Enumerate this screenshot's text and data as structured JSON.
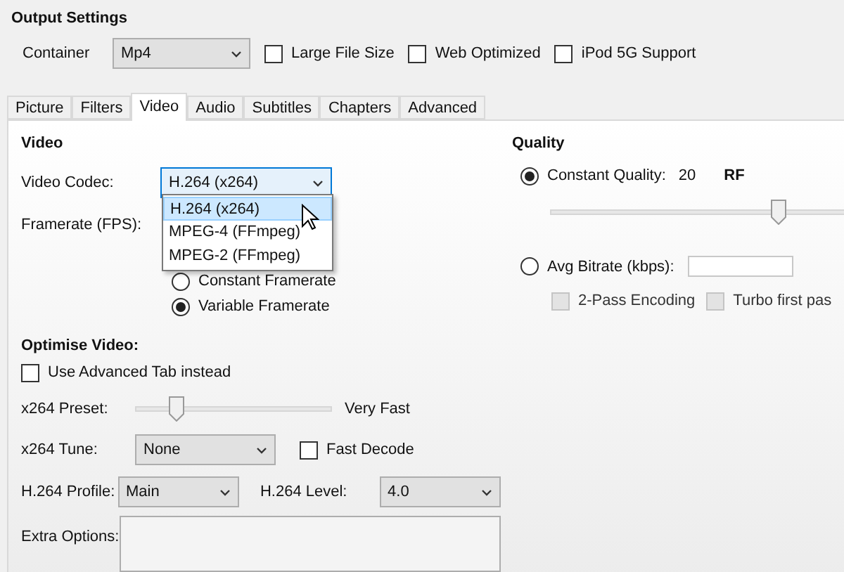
{
  "output_settings": {
    "title": "Output Settings",
    "container_label": "Container",
    "container_value": "Mp4",
    "options": [
      {
        "label": "Large File Size",
        "checked": false
      },
      {
        "label": "Web Optimized",
        "checked": false
      },
      {
        "label": "iPod 5G Support",
        "checked": false
      }
    ]
  },
  "tabs": [
    {
      "label": "Picture",
      "selected": false
    },
    {
      "label": "Filters",
      "selected": false
    },
    {
      "label": "Video",
      "selected": true
    },
    {
      "label": "Audio",
      "selected": false
    },
    {
      "label": "Subtitles",
      "selected": false
    },
    {
      "label": "Chapters",
      "selected": false
    },
    {
      "label": "Advanced",
      "selected": false
    }
  ],
  "video": {
    "title": "Video",
    "codec_label": "Video Codec:",
    "codec_value": "H.264 (x264)",
    "codec_options": [
      {
        "label": "H.264 (x264)",
        "selected": true
      },
      {
        "label": "MPEG-4 (FFmpeg)",
        "selected": false
      },
      {
        "label": "MPEG-2 (FFmpeg)",
        "selected": false
      }
    ],
    "framerate_label": "Framerate (FPS):",
    "framerate_modes": [
      {
        "label": "Constant Framerate",
        "selected": false
      },
      {
        "label": "Variable Framerate",
        "selected": true
      }
    ]
  },
  "quality": {
    "title": "Quality",
    "constant_label": "Constant Quality:",
    "constant_selected": true,
    "value": "20",
    "unit": "RF",
    "level": 0.77,
    "bitrate_label": "Avg Bitrate (kbps):",
    "bitrate_selected": false,
    "passes": [
      {
        "label": "2-Pass Encoding",
        "checked": false,
        "disabled": true
      },
      {
        "label": "Turbo first pas",
        "checked": false,
        "disabled": true
      }
    ]
  },
  "optimise": {
    "title": "Optimise Video:",
    "advanced_label": "Use Advanced Tab instead",
    "advanced_checked": false,
    "preset": {
      "label": "x264 Preset:",
      "level": 0.21,
      "value": "Very Fast"
    },
    "tune_label": "x264 Tune:",
    "tune_value": "None",
    "fast_decode_label": "Fast Decode",
    "fast_decode_checked": false,
    "profile_label": "H.264 Profile:",
    "profile_value": "Main",
    "level_label": "H.264 Level:",
    "level_value": "4.0",
    "extra_label": "Extra Options:"
  }
}
